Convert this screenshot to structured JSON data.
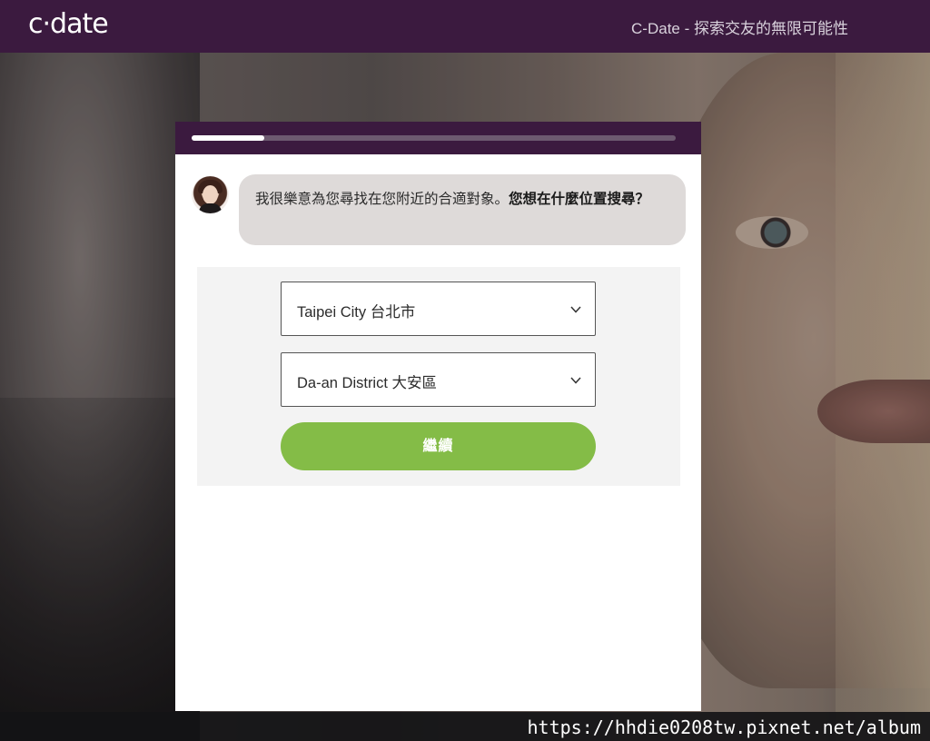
{
  "header": {
    "logo": "c·date",
    "tagline": "C-Date - 探索交友的無限可能性",
    "brand_color": "#3b1a3f"
  },
  "wizard": {
    "progress": 0.15,
    "avatar_icon": "avatar-woman-photo",
    "message": {
      "text": "我很樂意為您尋找在您附近的合適對象。",
      "question": "您想在什麼位置搜尋？"
    },
    "city_select": {
      "value": "Taipei City 台北市",
      "icon": "chevron-down-icon"
    },
    "district_select": {
      "value": "Da-an District 大安區",
      "icon": "chevron-down-icon"
    },
    "continue_button": {
      "label": "繼續",
      "color": "#84bc47"
    }
  },
  "watermark": "https://hhdie0208tw.pixnet.net/album"
}
